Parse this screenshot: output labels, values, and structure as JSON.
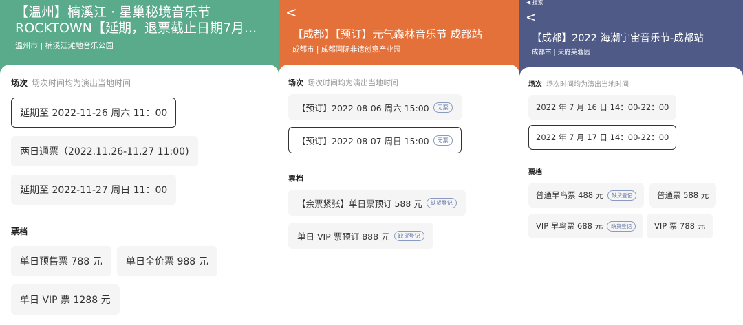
{
  "panel1": {
    "title_line1": "【温州】楠溪江 · 星巢秘境音乐节",
    "title_line2": "ROCKTOWN【延期，退票截止日期7月...",
    "subtitle": "温州市 | 楠溪江滩地音乐公园",
    "session_label": "场次",
    "session_hint": "场次时间均为演出当地时间",
    "sessions": [
      "延期至 2022-11-26 周六 11：00",
      "两日通票（2022.11.26-11.27 11:00)",
      "延期至 2022-11-27 周日 11：00"
    ],
    "ticket_label": "票档",
    "tickets": [
      "单日预售票 788 元",
      "单日全价票 988 元",
      "单日 VIP 票 1288 元"
    ],
    "colors": {
      "header": "#5aaa8c"
    }
  },
  "panel2": {
    "back_glyph": "<",
    "title": "【成都】【预订】元气森林音乐节 成都站",
    "subtitle": "成都市 | 成都国际非遗创意产业园",
    "session_label": "场次",
    "session_hint": "场次时间均为演出当地时间",
    "sessions": [
      {
        "text": "【预订】2022-08-06 周六 15:00",
        "tag": "无票"
      },
      {
        "text": "【预订】2022-08-07 周日 15:00",
        "tag": "无票"
      }
    ],
    "ticket_label": "票档",
    "tickets": [
      {
        "text": "【余票紧张】单日票预订 588 元",
        "tag": "缺货登记"
      },
      {
        "text": "单日 VIP 票预订 888 元",
        "tag": "缺货登记"
      }
    ],
    "colors": {
      "header": "#e4703a"
    }
  },
  "panel3": {
    "status_text": "◀ 搜索",
    "back_glyph": "<",
    "title": "【成都】2022 海潮宇宙音乐节-成都站",
    "subtitle": "成都市 | 天府芙蓉园",
    "session_label": "场次",
    "session_hint": "场次时间均为演出当地时间",
    "sessions": [
      "2022 年 7 月 16 日 14：00-22：00",
      "2022 年 7 月 17 日 14：00-22：00"
    ],
    "ticket_label": "票档",
    "tickets": [
      {
        "text": "普通早鸟票 488 元",
        "tag": "缺货登记"
      },
      {
        "text": "普通票 588 元",
        "tag": ""
      },
      {
        "text": "VIP 早鸟票 688 元",
        "tag": "缺货登记"
      },
      {
        "text": "VIP 票 788 元",
        "tag": ""
      }
    ],
    "colors": {
      "header": "#4f5b86"
    }
  }
}
